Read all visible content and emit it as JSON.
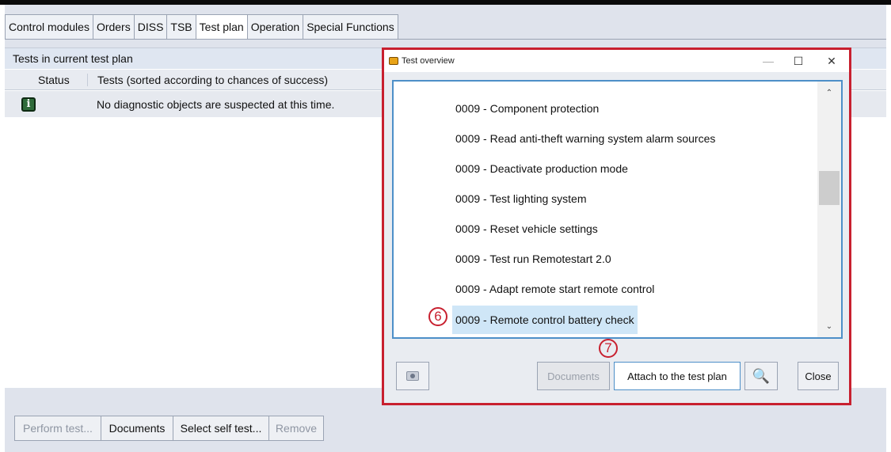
{
  "tabs": [
    {
      "label": "Control modules"
    },
    {
      "label": "Orders"
    },
    {
      "label": "DISS"
    },
    {
      "label": "TSB"
    },
    {
      "label": "Test plan"
    },
    {
      "label": "Operation"
    },
    {
      "label": "Special Functions"
    }
  ],
  "active_tab": "Test plan",
  "panel": {
    "title": "Tests in current test plan",
    "columns": {
      "status": "Status",
      "tests": "Tests (sorted according to chances of success)"
    },
    "rows": [
      {
        "status_icon": "info-icon",
        "text": "No diagnostic objects are suspected at this time."
      }
    ]
  },
  "bottom_toolbar": {
    "perform": "Perform test...",
    "documents": "Documents",
    "select_self_test": "Select self test...",
    "remove": "Remove"
  },
  "dialog": {
    "title": "Test overview",
    "window_controls": {
      "minimize": "—",
      "maximize": "☐",
      "close": "✕"
    },
    "items": [
      "0009 - Component protection",
      "0009 - Read anti-theft warning system alarm sources",
      "0009 - Deactivate production mode",
      "0009 - Test lighting system",
      "0009 - Reset vehicle settings",
      "0009 - Test run Remotestart 2.0",
      "0009 - Adapt remote start remote control",
      "0009  - Remote control battery check"
    ],
    "selected_index": 7,
    "markers": {
      "item": "6",
      "attach": "7"
    },
    "buttons": {
      "camera": "camera-icon",
      "documents": "Documents",
      "attach": "Attach to the test plan",
      "search": "magnifier-icon",
      "close": "Close"
    }
  },
  "colors": {
    "highlight_border": "#c8202f",
    "list_border": "#4d8fc8",
    "selection": "#cfe6f7"
  }
}
